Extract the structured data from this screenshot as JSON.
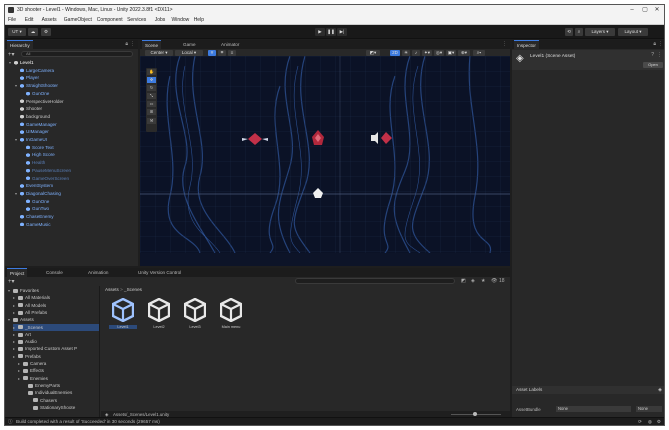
{
  "window": {
    "title": "3D shooter - Level1 - Windows, Mac, Linux - Unity 2022.3.8f1 <DX11>"
  },
  "menu": [
    "File",
    "Edit",
    "Assets",
    "GameObject",
    "Component",
    "Services",
    "Jobs",
    "Window",
    "Help"
  ],
  "toolbar": {
    "account": "UT",
    "layers": "Layers",
    "layout": "Layout"
  },
  "hierarchy": {
    "tab": "Hierarchy",
    "search_placeholder": "All",
    "items": [
      {
        "label": "Level1",
        "indent": 0,
        "color": "#ffffff"
      },
      {
        "label": "LargeCamera",
        "indent": 1,
        "color": "#7fb2ff"
      },
      {
        "label": "Player",
        "indent": 1,
        "color": "#7fb2ff"
      },
      {
        "label": "StraightShooter",
        "indent": 1,
        "color": "#7fb2ff"
      },
      {
        "label": "GunOne",
        "indent": 2,
        "color": "#7fb2ff"
      },
      {
        "label": "PerspectiveHolder",
        "indent": 1,
        "color": "#c8c8c8"
      },
      {
        "label": "Shooter",
        "indent": 1,
        "color": "#c8c8c8"
      },
      {
        "label": "background",
        "indent": 1,
        "color": "#c8c8c8"
      },
      {
        "label": "GameManager",
        "indent": 1,
        "color": "#7fb2ff"
      },
      {
        "label": "UIManager",
        "indent": 1,
        "color": "#7fb2ff"
      },
      {
        "label": "InGameUI",
        "indent": 1,
        "color": "#7fb2ff"
      },
      {
        "label": "Score Text",
        "indent": 2,
        "color": "#7fb2ff"
      },
      {
        "label": "High Score",
        "indent": 2,
        "color": "#7fb2ff"
      },
      {
        "label": "Health",
        "indent": 2,
        "color": "#5a7fb8"
      },
      {
        "label": "PauseMenuScreen",
        "indent": 2,
        "color": "#5a7fb8"
      },
      {
        "label": "GameOverScreen",
        "indent": 2,
        "color": "#5a7fb8"
      },
      {
        "label": "EventSystem",
        "indent": 1,
        "color": "#7fb2ff"
      },
      {
        "label": "DiagonalChasing",
        "indent": 1,
        "color": "#7fb2ff"
      },
      {
        "label": "GunOne",
        "indent": 2,
        "color": "#7fb2ff"
      },
      {
        "label": "GunTwo",
        "indent": 2,
        "color": "#7fb2ff"
      },
      {
        "label": "ChaseEnemy",
        "indent": 1,
        "color": "#7fb2ff"
      },
      {
        "label": "GameMusic",
        "indent": 1,
        "color": "#7fb2ff"
      }
    ]
  },
  "scene_view": {
    "tabs": [
      "Scene",
      "Game",
      "Animator"
    ],
    "pivot": "Center",
    "space": "Local",
    "mode": "2D"
  },
  "inspector": {
    "tab": "Inspector",
    "asset_title": "Level1 (Scene Asset)",
    "open_button": "Open",
    "asset_labels": "Asset Labels",
    "asset_bundle_label": "AssetBundle",
    "asset_bundle_value": "None",
    "asset_variant_value": "None"
  },
  "project": {
    "tabs": [
      "Project",
      "Console",
      "Animation",
      "Unity Version Control"
    ],
    "tree": [
      {
        "label": "Favorites",
        "indent": 0
      },
      {
        "label": "All Materials",
        "indent": 1
      },
      {
        "label": "All Models",
        "indent": 1
      },
      {
        "label": "All Prefabs",
        "indent": 1
      },
      {
        "label": "Assets",
        "indent": 0
      },
      {
        "label": "_Scenes",
        "indent": 1
      },
      {
        "label": "Art",
        "indent": 1
      },
      {
        "label": "Audio",
        "indent": 1
      },
      {
        "label": "Imported Custom Asset P",
        "indent": 1
      },
      {
        "label": "Prefabs",
        "indent": 1
      },
      {
        "label": "Camera",
        "indent": 2
      },
      {
        "label": "Effects",
        "indent": 2
      },
      {
        "label": "Enemies",
        "indent": 2
      },
      {
        "label": "EnemyParts",
        "indent": 3
      },
      {
        "label": "IndividualEnemies",
        "indent": 3
      },
      {
        "label": "Chasers",
        "indent": 4
      },
      {
        "label": "StationaryShoote",
        "indent": 4
      }
    ],
    "breadcrumb": [
      "Assets",
      "_Scenes"
    ],
    "assets": [
      "Level1",
      "Level2",
      "Level3",
      "Main menu"
    ],
    "path": "Assets/_Scenes/Level1.unity",
    "count": "18"
  },
  "status": "Build completed with a result of 'Succeeded' in 30 seconds (29657 ms)"
}
